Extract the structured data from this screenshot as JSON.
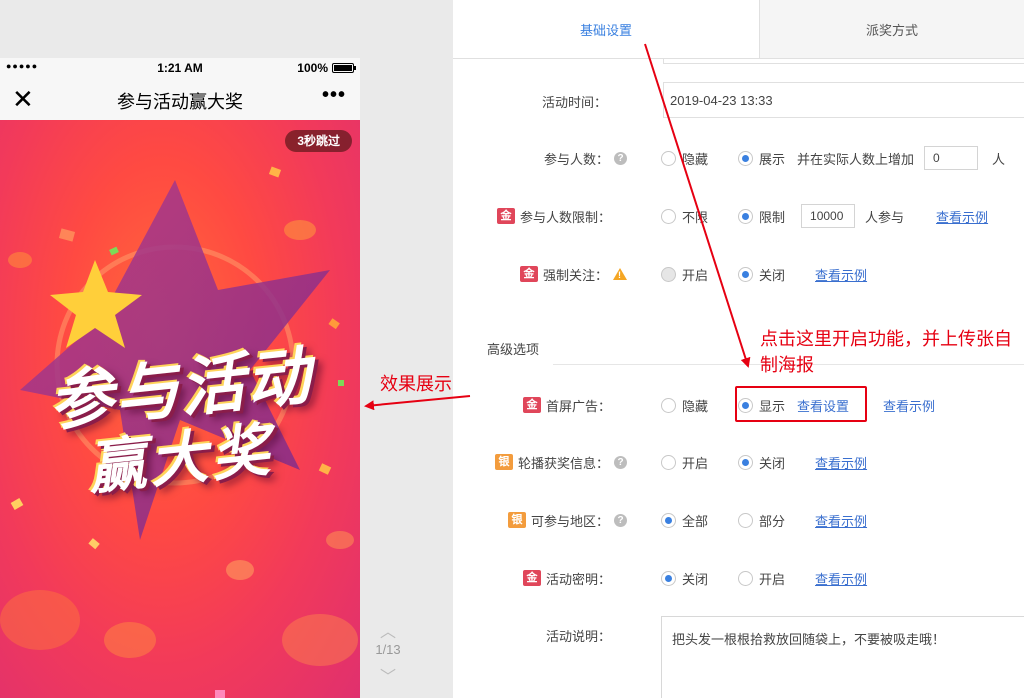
{
  "phone": {
    "signal": "●●●●●",
    "time": "1:21 AM",
    "battery": "100%",
    "title": "参与活动赢大奖",
    "more": "•••",
    "skip": "3秒跳过",
    "poster_line1": "参与活动",
    "poster_line2": "赢大奖"
  },
  "pager": {
    "page": "1/13"
  },
  "annotation": {
    "effect_label": "效果展示",
    "callout": "点击这里开启功能，并上传张自制海报",
    "color": "#e60012"
  },
  "tabs": [
    "基础设置",
    "派奖方式"
  ],
  "form": {
    "activity_time": {
      "label": "活动时间：",
      "value": "2019-04-23 13:33"
    },
    "participants": {
      "label": "参与人数：",
      "hide": "隐藏",
      "show": "展示",
      "increase_text": "并在实际人数上增加",
      "increase_value": "0",
      "unit": "人"
    },
    "participant_limit": {
      "badge": "金",
      "label": "参与人数限制：",
      "unlimited": "不限",
      "limited": "限制",
      "limit_value": "10000",
      "suffix": "人参与",
      "example": "查看示例"
    },
    "force_follow": {
      "badge": "金",
      "label": "强制关注：",
      "on": "开启",
      "off": "关闭",
      "example": "查看示例"
    },
    "advanced_title": "高级选项",
    "splash_ad": {
      "badge": "金",
      "label": "首屏广告：",
      "hide": "隐藏",
      "show": "显示",
      "settings": "查看设置",
      "example": "查看示例"
    },
    "carousel": {
      "badge": "银",
      "label": "轮播获奖信息：",
      "on": "开启",
      "off": "关闭",
      "example": "查看示例"
    },
    "region": {
      "badge": "银",
      "label": "可参与地区：",
      "all": "全部",
      "partial": "部分",
      "example": "查看示例"
    },
    "password": {
      "badge": "金",
      "label": "活动密明：",
      "off": "关闭",
      "on": "开启",
      "example": "查看示例"
    },
    "description": {
      "label": "活动说明：",
      "value": "把头发一根根拾救放回随袋上，不要被吸走哦！"
    }
  },
  "colors": {
    "accent": "#3a80e0",
    "gold_badge": "#e0465a",
    "silver_badge": "#f39c3d"
  }
}
